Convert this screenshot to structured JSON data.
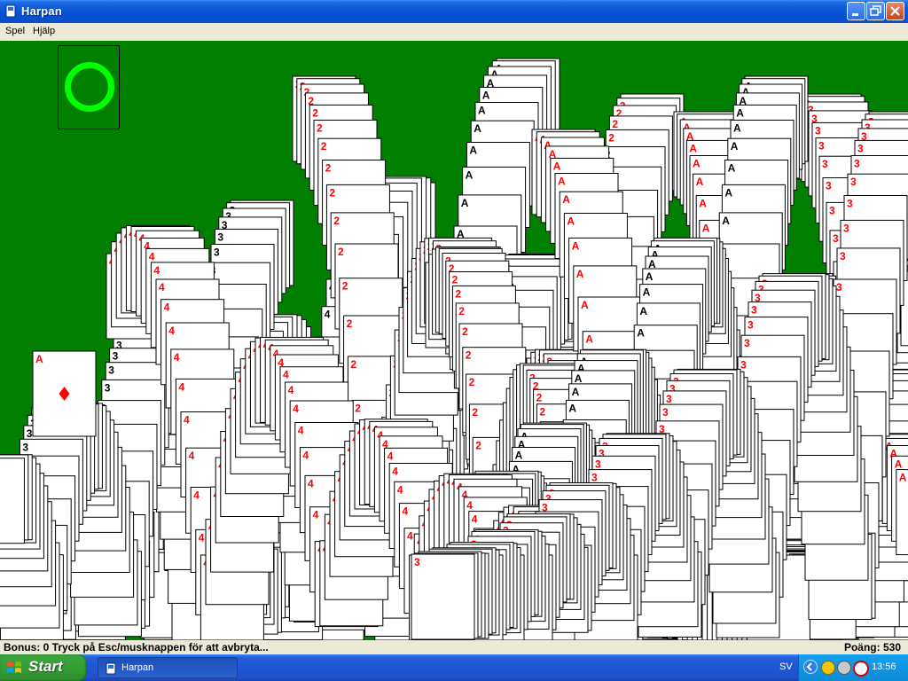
{
  "window": {
    "title": "Harpan"
  },
  "menu": {
    "items": [
      "Spel",
      "Hjälp"
    ]
  },
  "status": {
    "message": "Bonus: 0  Tryck på Esc/musknappen för att avbryta...",
    "score": "Poäng: 530"
  },
  "taskbar": {
    "start_label": "Start",
    "task_label": "Harpan",
    "language": "SV",
    "clock": "13:56"
  },
  "colors": {
    "felt": "#007f00",
    "recycle_ring": "#00ff00",
    "red_suit": "#ff0000",
    "black_suit": "#000000"
  },
  "icons": [
    "app-icon",
    "minimize-icon",
    "maximize-icon",
    "close-icon",
    "windows-logo-icon",
    "recycle-ring-icon",
    "chevron-left-icon",
    "network-icon",
    "volume-icon",
    "antivirus-icon"
  ],
  "cards": {
    "featured": {
      "rank": "A",
      "suit": "diamond"
    },
    "trail_labels": [
      "A",
      "2",
      "3",
      "4",
      "A",
      "2",
      "3",
      "A",
      "2",
      "A",
      "4",
      "3",
      "A"
    ]
  }
}
